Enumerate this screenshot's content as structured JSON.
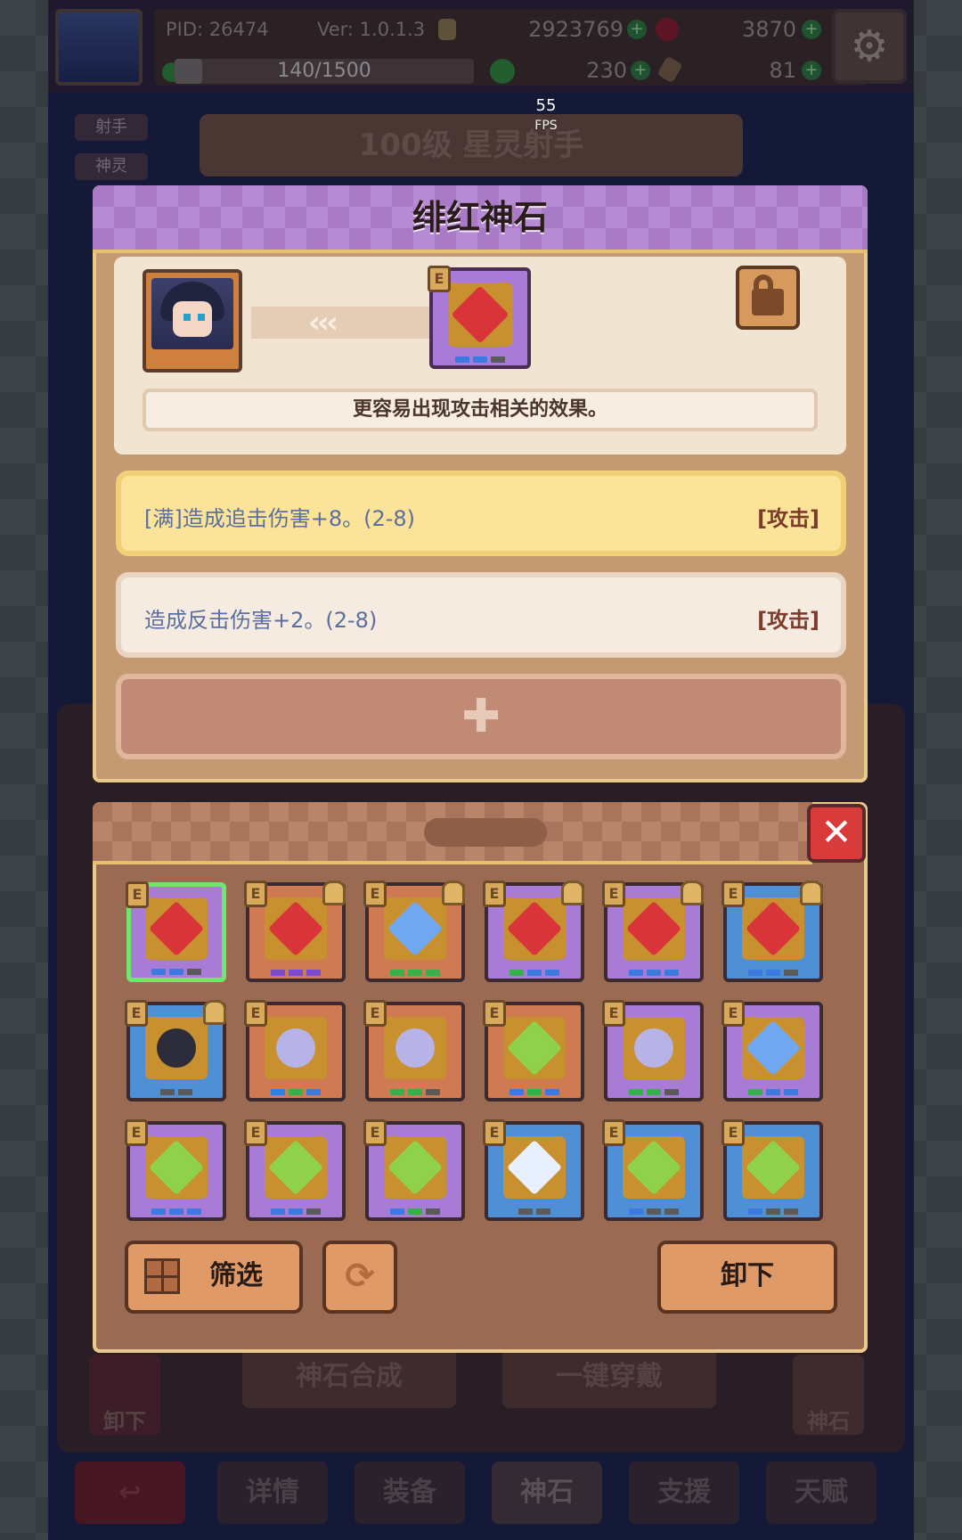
{
  "hud": {
    "pid": "PID: 26474",
    "version": "Ver: 1.0.1.3",
    "gold": "2923769",
    "red_gems": "3870",
    "exp": "140/1500",
    "exp_progress": 0.093,
    "clovers": "230",
    "items": "81",
    "fps": "55",
    "fps_label": "FPS"
  },
  "background": {
    "side_tags": [
      "射手",
      "神灵"
    ],
    "hero_title": "100级  星灵射手",
    "bottom_buttons": {
      "unequip": "卸下",
      "synthesize": "神石合成",
      "equip_all": "一键穿戴",
      "godstone": "神石"
    },
    "tabs": [
      "详情",
      "装备",
      "神石",
      "支援",
      "天赋"
    ],
    "active_tab": "神石"
  },
  "dialog": {
    "title": "绯红神石",
    "arrows": "‹‹‹",
    "description": "更容易出现攻击相关的效果。",
    "effects": [
      {
        "text": "[满]造成追击伤害+8。(2-8)",
        "tag": "[攻击]",
        "highlight": true
      },
      {
        "text": "造成反击伤害+2。(2-8)",
        "tag": "[攻击]",
        "highlight": false
      }
    ],
    "add_symbol": "✚"
  },
  "inventory": {
    "close_symbol": "✕",
    "filter_label": "筛选",
    "refresh_symbol": "⟳",
    "unequip_label": "卸下",
    "badge_letter": "E",
    "items": [
      {
        "bg": "purple",
        "gem": "red",
        "locked": false,
        "selected": true,
        "dots": [
          "blue",
          "blue",
          "gray"
        ]
      },
      {
        "bg": "orange",
        "gem": "red",
        "locked": true,
        "selected": false,
        "dots": [
          "purple",
          "purple",
          "purple"
        ]
      },
      {
        "bg": "orange",
        "gem": "blue",
        "locked": true,
        "selected": false,
        "dots": [
          "green",
          "green",
          "green"
        ]
      },
      {
        "bg": "purple",
        "gem": "red",
        "locked": true,
        "selected": false,
        "dots": [
          "green",
          "blue",
          "blue"
        ]
      },
      {
        "bg": "purple",
        "gem": "red",
        "locked": true,
        "selected": false,
        "dots": [
          "blue",
          "blue",
          "blue"
        ]
      },
      {
        "bg": "blue",
        "gem": "red",
        "locked": true,
        "selected": false,
        "dots": [
          "blue",
          "blue",
          "gray"
        ]
      },
      {
        "bg": "blue",
        "gem": "black",
        "locked": true,
        "selected": false,
        "dots": [
          "gray",
          "gray"
        ]
      },
      {
        "bg": "orange",
        "gem": "purple",
        "locked": false,
        "selected": false,
        "dots": [
          "blue",
          "green",
          "blue"
        ]
      },
      {
        "bg": "orange",
        "gem": "purple",
        "locked": false,
        "selected": false,
        "dots": [
          "green",
          "green",
          "gray"
        ]
      },
      {
        "bg": "orange",
        "gem": "green",
        "locked": false,
        "selected": false,
        "dots": [
          "blue",
          "green",
          "blue"
        ]
      },
      {
        "bg": "purple",
        "gem": "purple",
        "locked": false,
        "selected": false,
        "dots": [
          "green",
          "green",
          "gray"
        ]
      },
      {
        "bg": "purple",
        "gem": "blue",
        "locked": false,
        "selected": false,
        "dots": [
          "green",
          "blue",
          "blue"
        ]
      },
      {
        "bg": "purple",
        "gem": "green",
        "locked": false,
        "selected": false,
        "dots": [
          "blue",
          "blue",
          "blue"
        ]
      },
      {
        "bg": "purple",
        "gem": "green",
        "locked": false,
        "selected": false,
        "dots": [
          "blue",
          "blue",
          "gray"
        ]
      },
      {
        "bg": "purple",
        "gem": "green",
        "locked": false,
        "selected": false,
        "dots": [
          "blue",
          "green",
          "gray"
        ]
      },
      {
        "bg": "blue",
        "gem": "white",
        "locked": false,
        "selected": false,
        "dots": [
          "gray",
          "gray"
        ]
      },
      {
        "bg": "blue",
        "gem": "green",
        "locked": false,
        "selected": false,
        "dots": [
          "blue",
          "gray",
          "gray"
        ]
      },
      {
        "bg": "blue",
        "gem": "green",
        "locked": false,
        "selected": false,
        "dots": [
          "blue",
          "gray",
          "gray"
        ]
      }
    ]
  },
  "colors": {
    "bg_purple": "#a77bd6",
    "bg_orange": "#cf7a52",
    "bg_blue": "#4f8fd6",
    "gem_red": "#d8343a",
    "gem_blue": "#6fa8f0",
    "gem_green": "#8fd14a",
    "gem_purple": "#b7b3e6",
    "gem_black": "#2c2c3a",
    "gem_white": "#e8f0ff",
    "dot_blue": "#3b7be0",
    "dot_green": "#35b04a",
    "dot_purple": "#7a4bd0",
    "dot_gray": "#5a5a5a",
    "selected_border": "#6ee86a",
    "highlight_row": "#fbe39a"
  }
}
